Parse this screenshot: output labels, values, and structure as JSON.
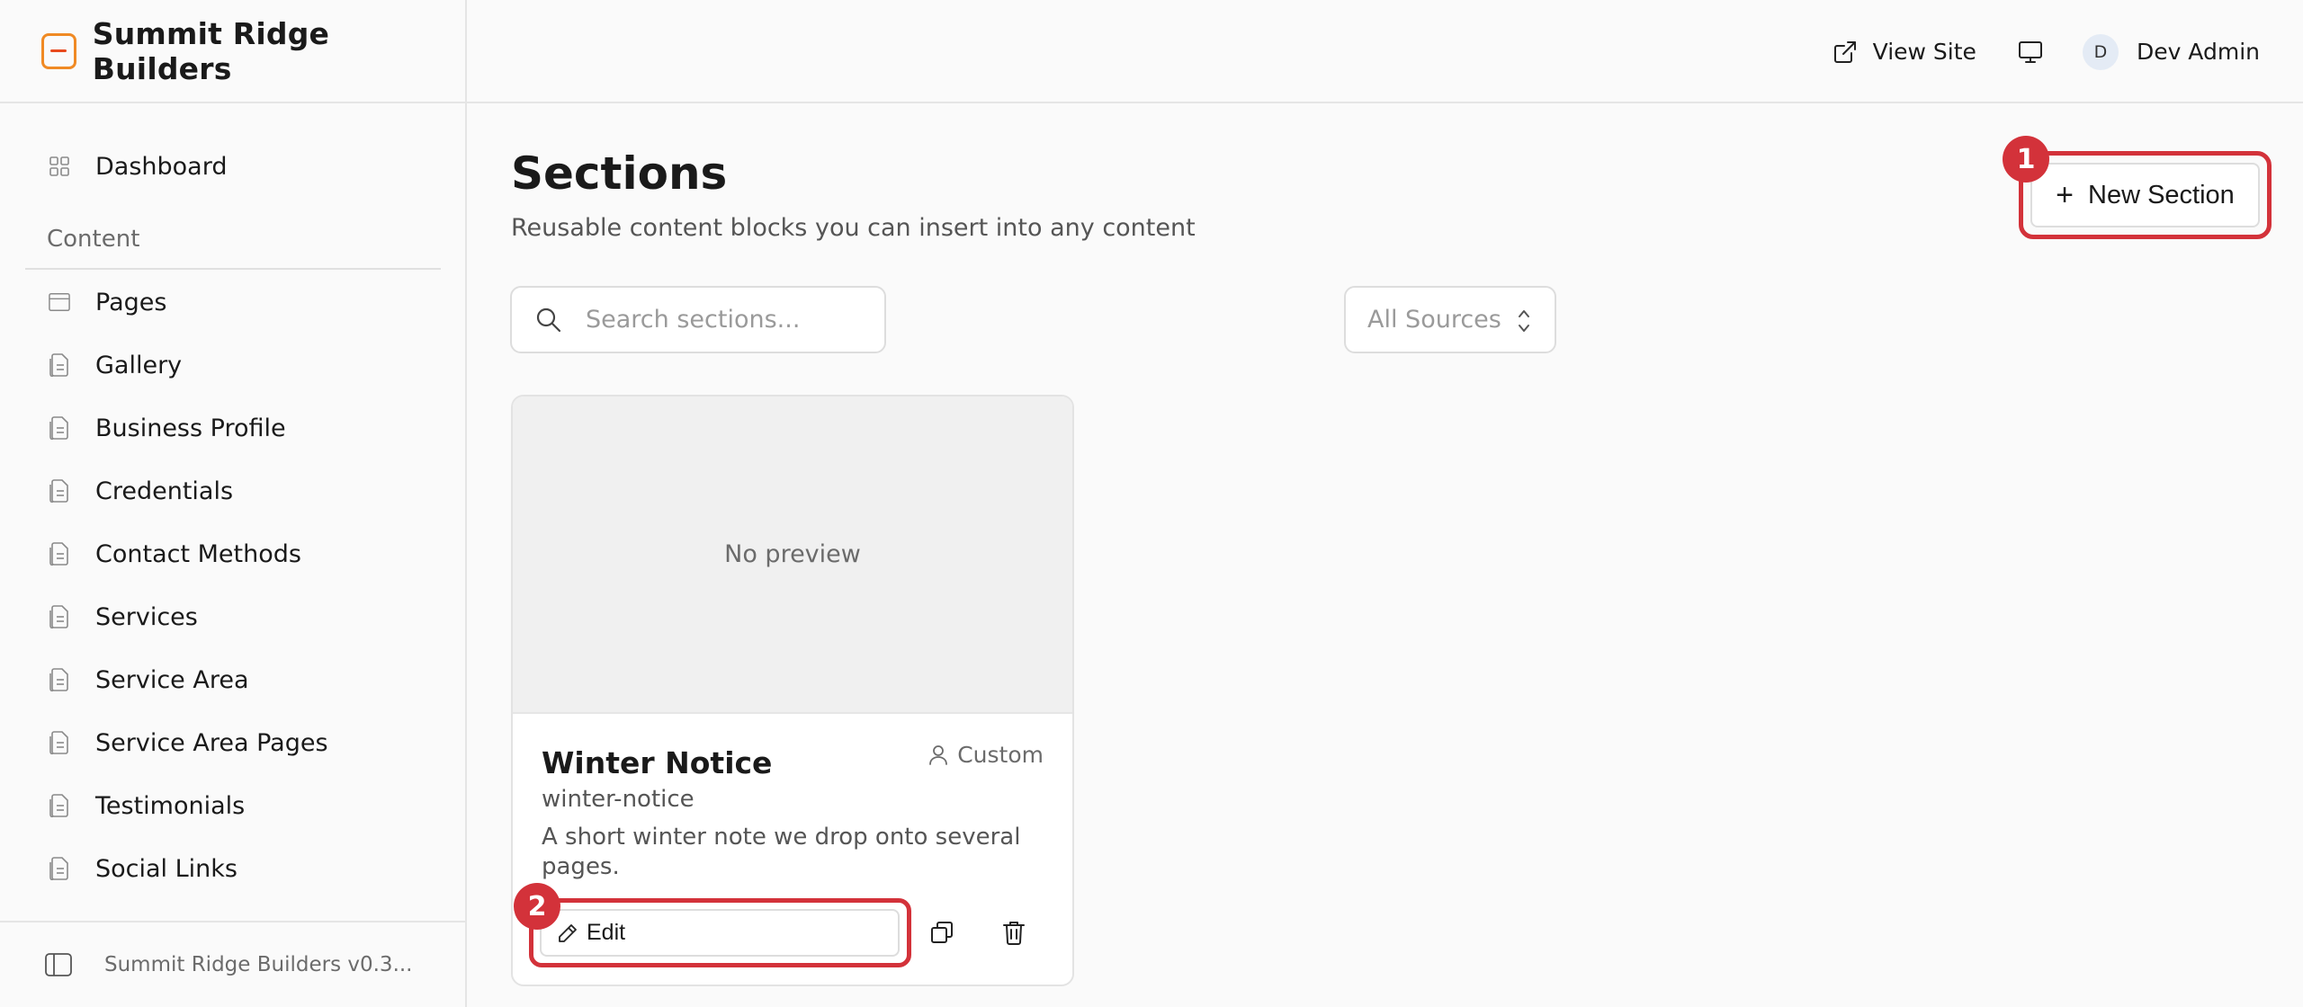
{
  "app": {
    "name": "Summit Ridge Builders",
    "version_label": "Summit Ridge Builders v0.3..."
  },
  "header": {
    "view_site": "View Site",
    "user_initial": "D",
    "user_name": "Dev Admin"
  },
  "sidebar": {
    "dashboard": "Dashboard",
    "section_label": "Content",
    "items": [
      {
        "label": "Pages",
        "icon": "page-icon"
      },
      {
        "label": "Gallery",
        "icon": "document-icon"
      },
      {
        "label": "Business Profile",
        "icon": "document-icon"
      },
      {
        "label": "Credentials",
        "icon": "document-icon"
      },
      {
        "label": "Contact Methods",
        "icon": "document-icon"
      },
      {
        "label": "Services",
        "icon": "document-icon"
      },
      {
        "label": "Service Area",
        "icon": "document-icon"
      },
      {
        "label": "Service Area Pages",
        "icon": "document-icon"
      },
      {
        "label": "Testimonials",
        "icon": "document-icon"
      },
      {
        "label": "Social Links",
        "icon": "document-icon"
      }
    ]
  },
  "main": {
    "title": "Sections",
    "subtitle": "Reusable content blocks you can insert into any content",
    "new_button": "New Section",
    "search_placeholder": "Search sections...",
    "source_filter": "All Sources"
  },
  "annotations": {
    "badge_1": "1",
    "badge_2": "2",
    "color": "#d3323a"
  },
  "cards": [
    {
      "preview": "No preview",
      "title": "Winter Notice",
      "slug": "winter-notice",
      "source": "Custom",
      "description": "A short winter note we drop onto several pages.",
      "edit_label": "Edit"
    }
  ]
}
